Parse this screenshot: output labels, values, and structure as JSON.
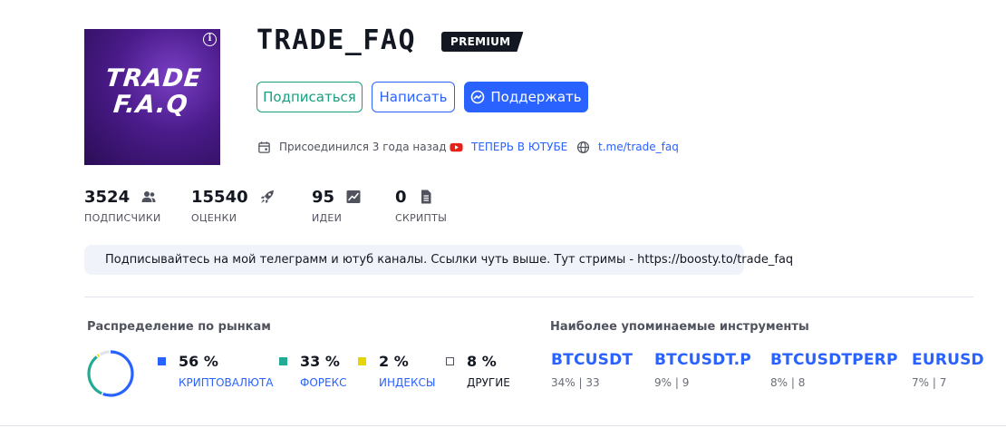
{
  "profile": {
    "avatar_text_line1": "TRADE",
    "avatar_text_line2": "F.A.Q",
    "name": "TRADE_FAQ",
    "badge": "PREMIUM"
  },
  "actions": {
    "subscribe": "Подписаться",
    "message": "Написать",
    "support": "Поддержать"
  },
  "meta": {
    "joined": "Присоединился 3 года назад",
    "youtube": "ТЕПЕРЬ В ЮТУБЕ",
    "telegram": "t.me/trade_faq"
  },
  "stats": {
    "followers": {
      "value": "3524",
      "label": "ПОДПИСЧИКИ"
    },
    "likes": {
      "value": "15540",
      "label": "ОЦЕНКИ"
    },
    "ideas": {
      "value": "95",
      "label": "ИДЕИ"
    },
    "scripts": {
      "value": "0",
      "label": "СКРИПТЫ"
    }
  },
  "description": "Подписывайтесь на мой телеграмм и ютуб каналы. Ссылки чуть выше. Тут стримы - https://boosty.to/trade_faq",
  "markets": {
    "title": "Распределение по рынкам",
    "items": [
      {
        "pct": "56 %",
        "name": "КРИПТОВАЛЮТА",
        "color": "#2962ff",
        "value": 56
      },
      {
        "pct": "33 %",
        "name": "ФОРЕКС",
        "color": "#22ab94",
        "value": 33
      },
      {
        "pct": "2 %",
        "name": "ИНДЕКСЫ",
        "color": "#e5d500",
        "value": 2
      },
      {
        "pct": "8 %",
        "name": "ДРУГИЕ",
        "color": "#ffffff",
        "value": 8
      }
    ]
  },
  "instruments": {
    "title": "Наиболее упоминаемые инструменты",
    "items": [
      {
        "symbol": "BTCUSDT",
        "stats": "34% | 33"
      },
      {
        "symbol": "BTCUSDT.P",
        "stats": "9% | 9"
      },
      {
        "symbol": "BTCUSDTPERP",
        "stats": "8% | 8"
      },
      {
        "symbol": "EURUSD",
        "stats": "7% | 7"
      }
    ]
  },
  "colors": {
    "accent": "#2962ff",
    "green": "#1a9e7f",
    "youtube_red": "#ff0000"
  }
}
